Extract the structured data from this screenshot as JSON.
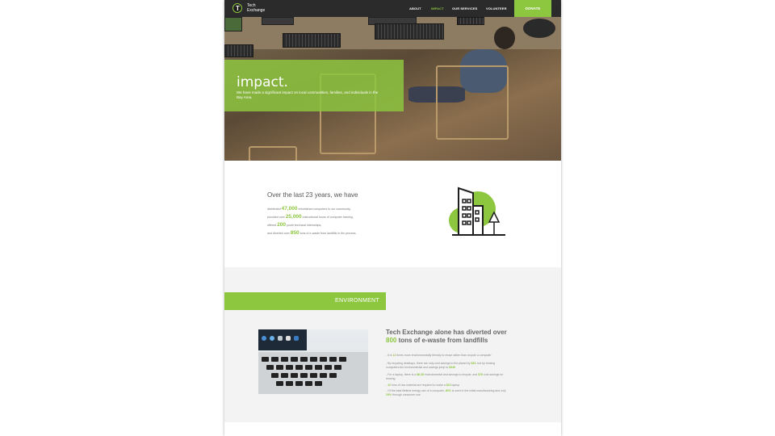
{
  "brand": {
    "logo_letter": "T",
    "line1": "Tech",
    "line2": "Exchange"
  },
  "nav": {
    "links": [
      {
        "label": "ABOUT"
      },
      {
        "label": "IMPACT"
      },
      {
        "label": "OUR SERVICES"
      },
      {
        "label": "VOLUNTEER"
      }
    ],
    "donate": "DONATE",
    "active": "IMPACT"
  },
  "hero": {
    "title": "impact.",
    "subtitle": "We have made a significant impact on local communities, families, and individuals in the Bay Area."
  },
  "stats": {
    "title": "Over the last 23 years, we have",
    "lines": [
      {
        "pre": "distributed ",
        "num": "47,000",
        "post": " refurbished computers to our community,"
      },
      {
        "pre": "provided over ",
        "num": "25,000",
        "post": " instructional hours of computer training,"
      },
      {
        "pre": "offered ",
        "num": "200",
        "post": " youth technical internships,"
      },
      {
        "pre": "and diverted over ",
        "num": "850",
        "post": " tons of e-waste from landfills in the process."
      }
    ]
  },
  "environment": {
    "section_label": "ENVIRONMENT",
    "heading_pre": "Tech Exchange alone has diverted over",
    "heading_num": "800",
    "heading_post": " tons of e-waste from landfills",
    "bullets": [
      {
        "pre": "- It is ",
        "num": "12",
        "post": " times more environmentally friendly to reuse rather than recycle a computer"
      },
      {
        "pre": "- By recycling desktops, there are only cost savings to the planet by ",
        "num": "$33",
        "post": ", but by reusing computers the environmental and savings jump to ",
        "num2": "$346"
      },
      {
        "pre": "- For a laptop, there is a ",
        "num": "$6.38",
        "post": " environmental and savings to recycle, and ",
        "num2": "$76",
        "post2": " cost savings for reusing"
      },
      {
        "pre": "- ",
        "num": "10",
        "post": " tons of raw material are required to make a ",
        "num2": "$10",
        "post2": " laptop"
      },
      {
        "pre": "- Of the total lifetime energy use of a computer, ",
        "num": "80%",
        "post": " is used in the initial manufacturing and only ",
        "num2": "20%",
        "post2": " through consumer use"
      }
    ]
  },
  "colors": {
    "accent": "#8dc63f",
    "nav_bg": "#2b2b2b",
    "section_bg": "#f3f3f3"
  },
  "icons": [
    "logo-icon",
    "city-building-icon",
    "laptop-photo"
  ]
}
